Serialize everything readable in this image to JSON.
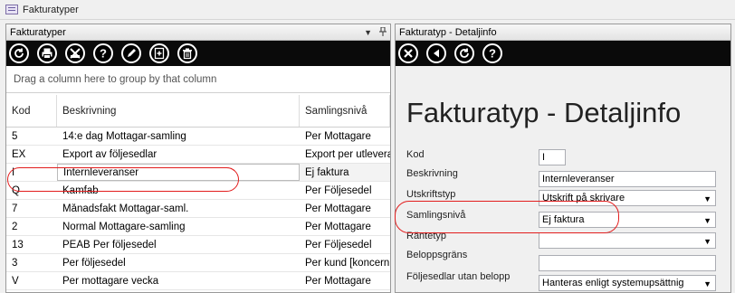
{
  "window": {
    "title": "Fakturatyper"
  },
  "left_pane": {
    "title": "Fakturatyper",
    "dropdown_glyph": "▼",
    "pin_glyph": "📌",
    "toolbar_icons": [
      "refresh-icon",
      "print-icon",
      "excel-icon",
      "help-icon",
      "edit-icon",
      "add-icon",
      "delete-icon"
    ],
    "group_hint": "Drag a column here to group by that column",
    "columns": [
      "Kod",
      "Beskrivning",
      "Samlingsnivå"
    ],
    "rows": [
      {
        "kod": "5",
        "beskrivning": "14:e dag Mottagar-samling",
        "samlingsniva": "Per Mottagare"
      },
      {
        "kod": "EX",
        "beskrivning": "Export av följesedlar",
        "samlingsniva": "Export per utleverans"
      },
      {
        "kod": "I",
        "beskrivning": "Internleveranser",
        "samlingsniva": "Ej faktura"
      },
      {
        "kod": "Q",
        "beskrivning": "Kamfab",
        "samlingsniva": "Per Följesedel"
      },
      {
        "kod": "7",
        "beskrivning": "Månadsfakt Mottagar-saml.",
        "samlingsniva": "Per Mottagare"
      },
      {
        "kod": "2",
        "beskrivning": "Normal Mottagare-samling",
        "samlingsniva": "Per Mottagare"
      },
      {
        "kod": "13",
        "beskrivning": "PEAB Per följesedel",
        "samlingsniva": "Per Följesedel"
      },
      {
        "kod": "3",
        "beskrivning": "Per följesedel",
        "samlingsniva": "Per kund [koncernbolag]"
      },
      {
        "kod": "V",
        "beskrivning": "Per mottagare vecka",
        "samlingsniva": "Per Mottagare"
      }
    ]
  },
  "right_pane": {
    "title": "Fakturatyp - Detaljinfo",
    "toolbar_icons": [
      "close-icon",
      "back-icon",
      "refresh-icon",
      "help-icon"
    ],
    "heading": "Fakturatyp - Detaljinfo",
    "fields": {
      "kod": {
        "label": "Kod",
        "value": "I"
      },
      "beskrivning": {
        "label": "Beskrivning",
        "value": "Internleveranser"
      },
      "utskriftstyp": {
        "label": "Utskriftstyp",
        "value": "Utskrift på skrivare"
      },
      "samlingsniva": {
        "label": "Samlingsnivå",
        "value": "Ej faktura"
      },
      "rantetyp": {
        "label": "Räntetyp",
        "value": ""
      },
      "beloppsgrans": {
        "label": "Beloppsgräns",
        "value": ""
      },
      "foljesedlar": {
        "label": "Följesedlar utan belopp",
        "value": "Hanteras enligt systemupsättnig"
      }
    },
    "dropdown_glyph": "▼"
  },
  "colors": {
    "highlight": "#e21d1d",
    "toolbar_bg": "#0a0a0a"
  }
}
